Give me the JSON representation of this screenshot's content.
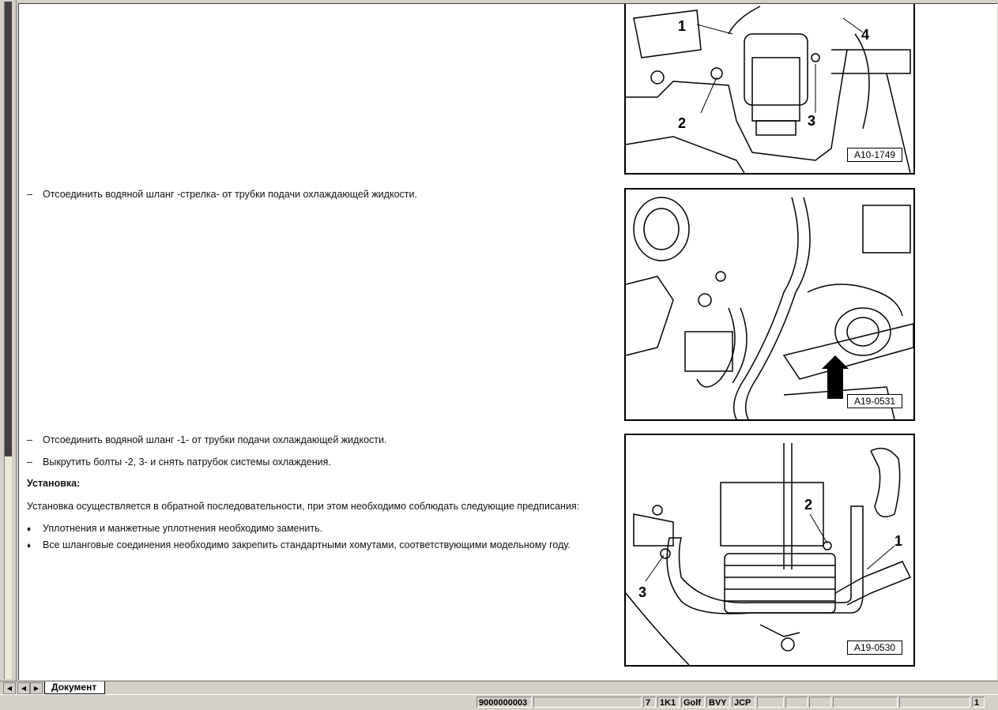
{
  "document": {
    "instruction_1": "Отсоединить водяной шланг -стрелка- от трубки подачи охлаждающей жидкости.",
    "instruction_2": "Отсоединить водяной шланг -1- от трубки подачи охлаждающей жидкости.",
    "instruction_3": "Выкрутить болты -2, 3- и снять патрубок системы охлаждения.",
    "dash": "–",
    "section_heading": "Установка:",
    "install_text": "Установка осуществляется в обратной последовательности, при этом необходимо соблюдать следующие предписания:",
    "bullet_symbol": "♦",
    "bullet_1": "Уплотнения и манжетные уплотнения необходимо заменить.",
    "bullet_2": "Все шланговые соединения необходимо закрепить стандартными хомутами, соответствующими модельному году."
  },
  "figures": [
    {
      "code": "A10-1749",
      "callouts": [
        "1",
        "2",
        "3",
        "4"
      ]
    },
    {
      "code": "A19-0531",
      "callouts": []
    },
    {
      "code": "A19-0530",
      "callouts": [
        "1",
        "2",
        "3"
      ]
    }
  ],
  "tabs": {
    "document_tab": "Документ",
    "first_icon": "first-page-icon",
    "prev_icon": "prev-page-icon",
    "next_icon": "next-page-icon"
  },
  "statusbar": {
    "doc_number": "9000000003",
    "c1": "7",
    "c2": "1K1",
    "c3": "Golf",
    "c4": "BVY",
    "c5": "JCP",
    "page": "1"
  }
}
